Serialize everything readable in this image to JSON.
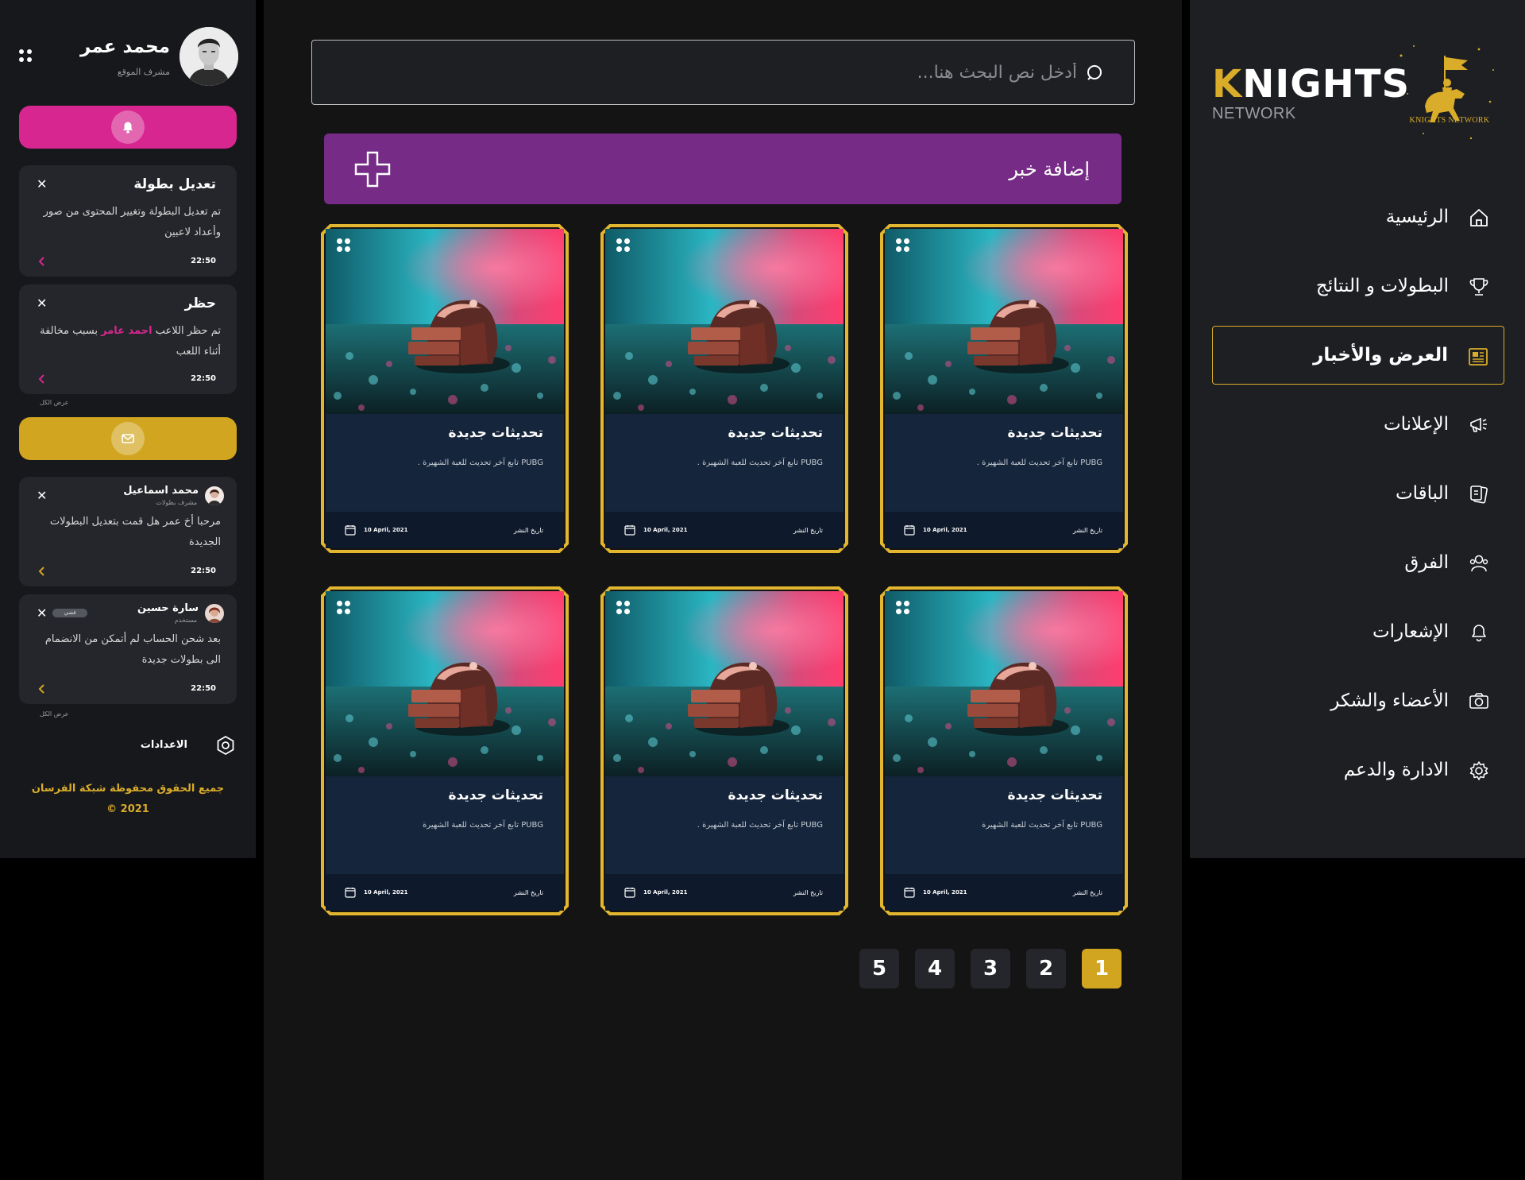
{
  "brand": {
    "wordmark_first": "K",
    "wordmark_rest": "NIGHTS",
    "sub": "NETWORK",
    "emblem_text": "KNIGHTS NETWORK",
    "accent_color": "#d9ac2a"
  },
  "nav": {
    "items": [
      {
        "label": "الرئيسية",
        "icon": "home-icon",
        "active": false
      },
      {
        "label": "البطولات و النتائج",
        "icon": "trophy-icon",
        "active": false
      },
      {
        "label": "العرض والأخبار",
        "icon": "newspaper-icon",
        "active": true
      },
      {
        "label": "الإعلانات",
        "icon": "megaphone-icon",
        "active": false
      },
      {
        "label": "الباقات",
        "icon": "package-icon",
        "active": false
      },
      {
        "label": "الفرق",
        "icon": "team-icon",
        "active": false
      },
      {
        "label": "الإشعارات",
        "icon": "bell-icon",
        "active": false
      },
      {
        "label": "الأعضاء والشكر",
        "icon": "members-icon",
        "active": false
      },
      {
        "label": "الادارة والدعم",
        "icon": "gear-icon",
        "active": false
      }
    ]
  },
  "profile": {
    "name": "محمد عمر",
    "role": "مشرف الموقع"
  },
  "notifications": {
    "pill_color": "#d7268f",
    "items": [
      {
        "title": "تعديل بطولة",
        "body": "تم تعديل البطولة وتغيير المحتوى من صور وأعداد لاعبين",
        "time": "22:50"
      },
      {
        "title": "حظر",
        "body_before": "تم حظر اللاعب ",
        "body_highlight": "احمد عامر",
        "body_after": " بسبب مخالفة أثناء اللعب",
        "time": "22:50"
      }
    ],
    "see_all": "عرض الكل"
  },
  "messages": {
    "pill_color": "#d2a520",
    "items": [
      {
        "name": "محمد اسماعيل",
        "role": "مشرف بطولات",
        "body": "مرحبا أخ عمر هل قمت بتعديل البطولات الجديدة",
        "time": "22:50",
        "badge": ""
      },
      {
        "name": "سارة حسين",
        "role": "مستخدم",
        "body": "بعد شحن الحساب لم أتمكن من الانضمام الى بطولات جديدة",
        "time": "22:50",
        "badge": "فضي"
      }
    ],
    "see_all": "عرض الكل"
  },
  "settings": {
    "label": "الاعدادات"
  },
  "footer": {
    "copyright": "جميع الحقوق محفوظة شبكة الفرسان",
    "year": "© 2021"
  },
  "search": {
    "placeholder": "أدخل نص البحث هنا..."
  },
  "add_news": {
    "label": "إضافة خبر",
    "color": "#762c86"
  },
  "news": {
    "date_label": "تاريخ النشر",
    "cards": [
      {
        "title": "تحديثات جديدة",
        "desc": "PUBG تابع آخر تحديث للعبة الشهيرة .",
        "date": "10 April, 2021"
      },
      {
        "title": "تحديثات جديدة",
        "desc": "PUBG تابع آخر تحديث للعبة الشهيرة .",
        "date": "10 April, 2021"
      },
      {
        "title": "تحديثات جديدة",
        "desc": "PUBG تابع آخر تحديث للعبة الشهيرة .",
        "date": "10 April, 2021"
      },
      {
        "title": "تحديثات جديدة",
        "desc": "PUBG تابع آخر تحديث للعبة الشهيرة",
        "date": "10 April, 2021"
      },
      {
        "title": "تحديثات جديدة",
        "desc": "PUBG تابع آخر تحديث للعبة الشهيرة .",
        "date": "10 April, 2021"
      },
      {
        "title": "تحديثات جديدة",
        "desc": "PUBG تابع آخر تحديث للعبة الشهيرة",
        "date": "10 April, 2021"
      }
    ]
  },
  "pagination": {
    "pages": [
      "1",
      "2",
      "3",
      "4",
      "5"
    ],
    "current": "1"
  }
}
